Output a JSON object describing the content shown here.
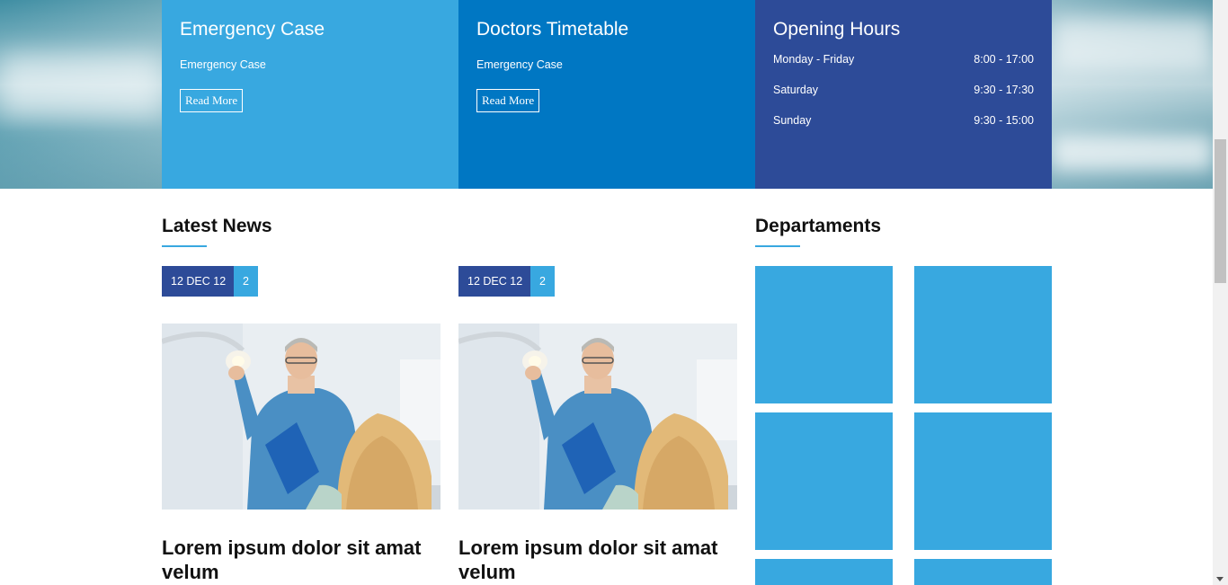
{
  "info_cards": [
    {
      "title": "Emergency Case",
      "text": "Emergency Case",
      "button": "Read More"
    },
    {
      "title": "Doctors Timetable",
      "text": "Emergency Case",
      "button": "Read More"
    },
    {
      "title": "Opening Hours",
      "hours": [
        {
          "day": "Monday - Friday",
          "time": "8:00 - 17:00"
        },
        {
          "day": "Saturday",
          "time": "9:30 - 17:30"
        },
        {
          "day": "Sunday",
          "time": "9:30 - 15:00"
        }
      ]
    }
  ],
  "latest_news": {
    "heading": "Latest News",
    "items": [
      {
        "date": "12 DEC 12",
        "count": "2",
        "title": "Lorem ipsum dolor sit amat velum"
      },
      {
        "date": "12 DEC 12",
        "count": "2",
        "title": "Lorem ipsum dolor sit amat velum"
      }
    ]
  },
  "departments": {
    "heading": "Departaments"
  },
  "colors": {
    "light_blue": "#38a8e0",
    "mid_blue": "#0077c3",
    "dark_blue": "#2d4b98"
  }
}
